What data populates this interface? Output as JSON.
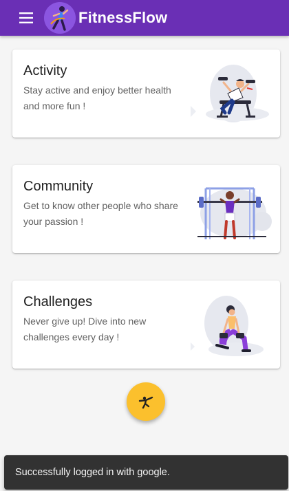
{
  "appbar": {
    "title": "FitnessFlow",
    "menu_icon": "hamburger-menu-icon",
    "logo": "fitness-logo",
    "color": "#6a2fb5"
  },
  "cards": [
    {
      "title": "Activity",
      "description": "Stay active and enjoy better health and more fun !",
      "illustration": "dumbbell-bench-illustration"
    },
    {
      "title": "Community",
      "description": "Get to know other people who share your passion !",
      "illustration": "barbell-rack-illustration"
    },
    {
      "title": "Challenges",
      "description": "Never give up! Dive into new challenges every day !",
      "illustration": "lunge-dumbbell-illustration"
    }
  ],
  "fab": {
    "icon": "karate-kick-icon",
    "color": "#fbc02d"
  },
  "snackbar": {
    "message": "Successfully logged in with google."
  }
}
